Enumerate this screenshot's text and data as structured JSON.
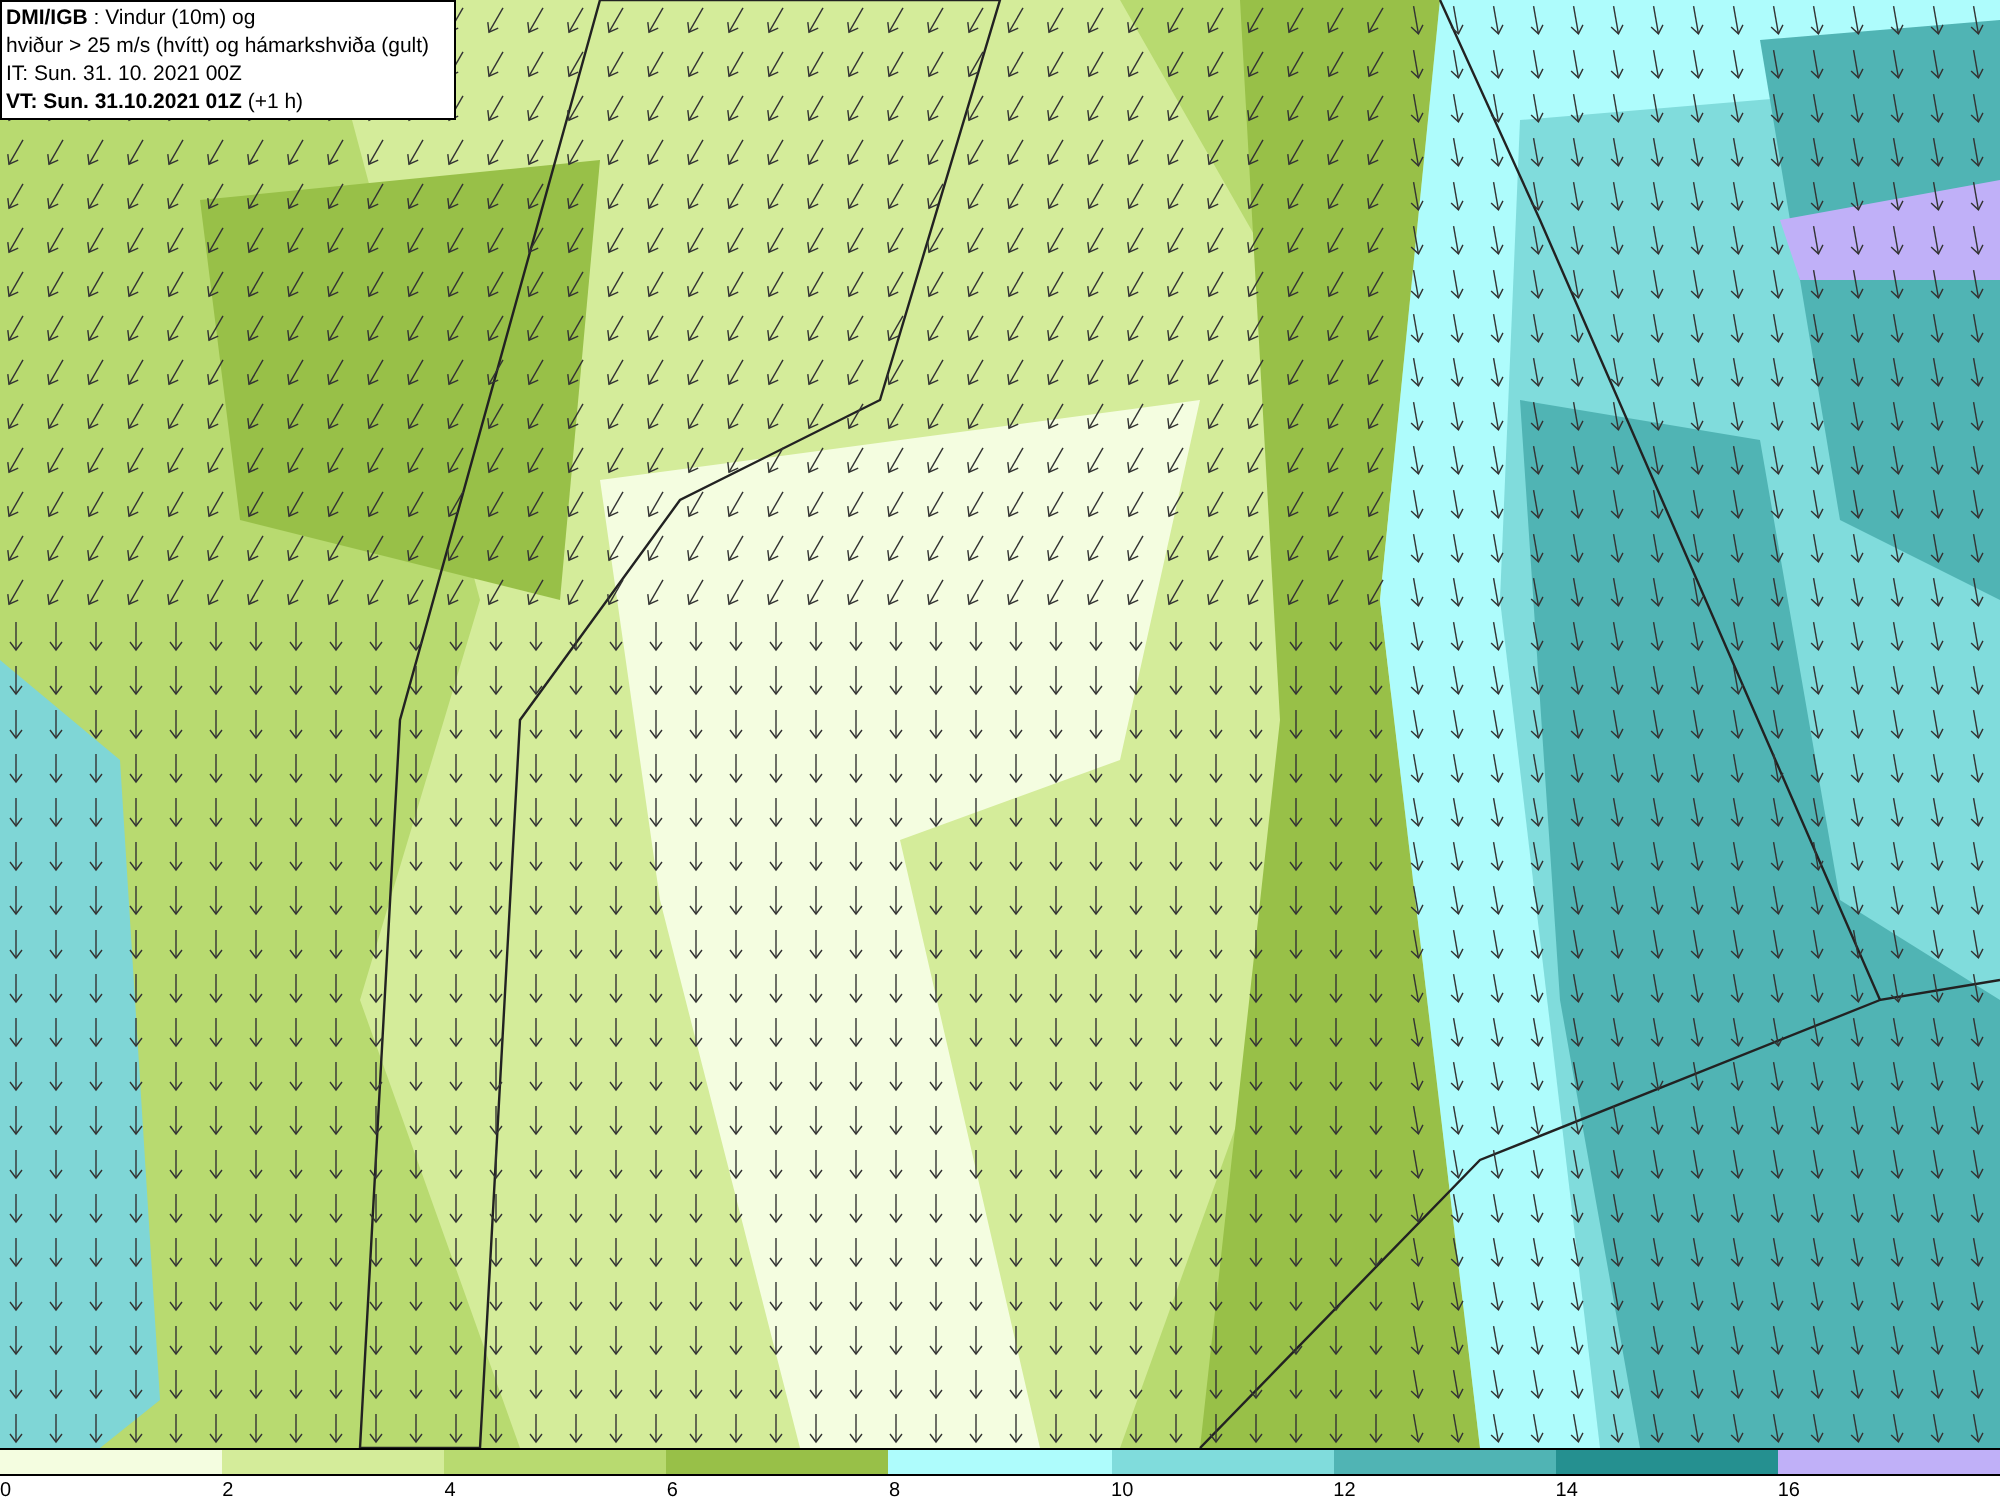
{
  "title_box": {
    "lines": [
      "**DMI/IGB** : Vindur (10m) og",
      "hviður > 25 m/s (hvítt) og hámarkshviða (gult)",
      "IT: Sun. 31. 10. 2021 00Z",
      "**VT: Sun. 31.10.2021 01Z** (+1 h)"
    ]
  },
  "legend": {
    "swatches": [
      {
        "color": "#f4fde0"
      },
      {
        "color": "#d4ec9a"
      },
      {
        "color": "#b8da70"
      },
      {
        "color": "#98c048"
      },
      {
        "color": "#aefcfc"
      },
      {
        "color": "#80dcdc"
      },
      {
        "color": "#50b4b4"
      },
      {
        "color": "#259090"
      },
      {
        "color": "#c0b0f8"
      }
    ],
    "ticks": [
      "0",
      "2",
      "4",
      "6",
      "8",
      "10",
      "12",
      "14",
      "16"
    ]
  }
}
